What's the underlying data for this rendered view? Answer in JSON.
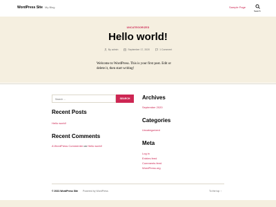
{
  "colors": {
    "accent": "#cd2653",
    "hero_bg": "#f5efe0",
    "muted": "#6d6d6d",
    "border": "#dcd7ca"
  },
  "header": {
    "site_title": "WordPress Site",
    "site_description": "My Blog",
    "nav_item": "Sample Page",
    "search_label": "Search",
    "search_icon": "search-icon"
  },
  "post": {
    "category": "UNCATEGORIZED",
    "title": "Hello world!",
    "meta": {
      "author": "By admin",
      "date": "September 17, 2020",
      "comments": "1 Comment"
    },
    "content": "Welcome to WordPress. This is your first post. Edit or delete it, then start writing!"
  },
  "widgets": {
    "search": {
      "placeholder": "Search ...",
      "button": "SEARCH"
    },
    "recent_posts": {
      "title": "Recent Posts",
      "items": [
        "Hello world!"
      ]
    },
    "recent_comments": {
      "title": "Recent Comments",
      "author": "A WordPress Commenter",
      "on": "on",
      "post": "Hello world!"
    },
    "archives": {
      "title": "Archives",
      "items": [
        "September 2020"
      ]
    },
    "categories": {
      "title": "Categories",
      "items": [
        "Uncategorized"
      ]
    },
    "meta": {
      "title": "Meta",
      "items": [
        "Log in",
        "Entries feed",
        "Comments feed",
        "WordPress.org"
      ]
    }
  },
  "footer": {
    "copyright": "© 2021 WordPress Site",
    "powered_by": "Powered by WordPress",
    "to_top": "To the top ↑"
  }
}
